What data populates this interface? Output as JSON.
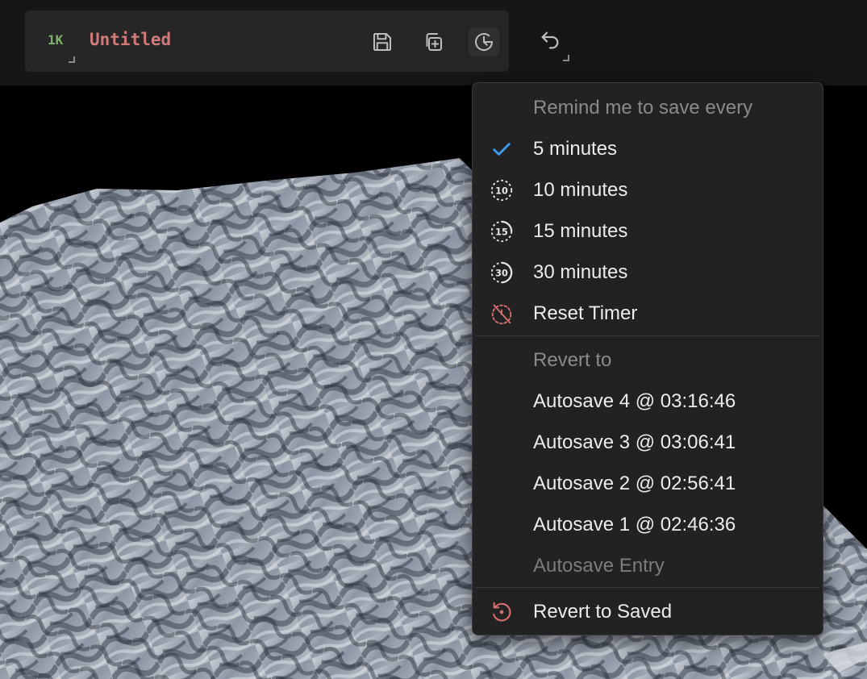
{
  "toolbar": {
    "resolution_badge": "1K",
    "document_title": "Untitled",
    "colors": {
      "badge": "#7db36a",
      "title": "#d07a7a",
      "background": "#161616",
      "group": "#262626"
    },
    "buttons": [
      {
        "name": "save-button",
        "icon": "floppy-disk-icon"
      },
      {
        "name": "save-copy-button",
        "icon": "duplicate-plus-icon"
      },
      {
        "name": "autosave-button",
        "icon": "clock-history-icon"
      },
      {
        "name": "undo-button",
        "icon": "undo-arrow-icon"
      }
    ]
  },
  "menu": {
    "remind_header": "Remind me to save every",
    "intervals": [
      {
        "label": "5 minutes",
        "icon": "check-icon",
        "selected": true
      },
      {
        "label": "10 minutes",
        "icon": "timer-10-icon",
        "selected": false
      },
      {
        "label": "15 minutes",
        "icon": "timer-15-icon",
        "selected": false
      },
      {
        "label": "30 minutes",
        "icon": "timer-30-icon",
        "selected": false
      }
    ],
    "reset_timer": "Reset Timer",
    "revert_header": "Revert to",
    "autosaves": [
      {
        "label": "Autosave 4 @ 03:16:46"
      },
      {
        "label": "Autosave 3 @ 03:06:41"
      },
      {
        "label": "Autosave 2 @ 02:56:41"
      },
      {
        "label": "Autosave 1 @ 02:46:36"
      }
    ],
    "autosave_entry": "Autosave Entry",
    "revert_saved": "Revert to Saved",
    "colors": {
      "check": "#3d9bf0",
      "danger_icon": "#d87070",
      "timer_icon": "#e6e6e6"
    }
  }
}
